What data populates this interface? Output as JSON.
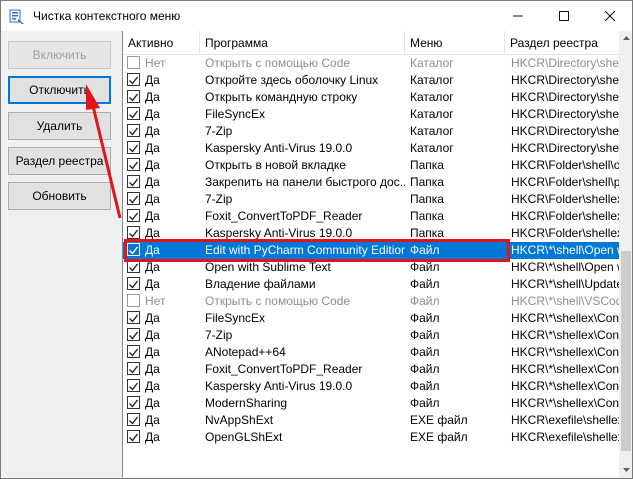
{
  "window": {
    "title": "Чистка контекстного меню",
    "controls": {
      "minimize": "minimize-icon",
      "maximize": "maximize-icon",
      "close": "close-icon"
    }
  },
  "buttons": {
    "enable": "Включить",
    "disable": "Отключить",
    "delete": "Удалить",
    "registry": "Раздел реестра",
    "refresh": "Обновить"
  },
  "columns": {
    "active": "Активно",
    "program": "Программа",
    "menu": "Меню",
    "registry": "Раздел реестра"
  },
  "rows": [
    {
      "checked": false,
      "active": "Нет",
      "program": "Открыть с помощью Code",
      "menu": "Каталог",
      "registry": "HKCR\\Directory\\shell\\VSCode",
      "selected": false
    },
    {
      "checked": true,
      "active": "Да",
      "program": "Откройте здесь оболочку Linux",
      "menu": "Каталог",
      "registry": "HKCR\\Directory\\shell\\WSL",
      "selected": false
    },
    {
      "checked": true,
      "active": "Да",
      "program": "Открыть командную строку",
      "menu": "Каталог",
      "registry": "HKCR\\Directory\\shell\\cmd",
      "selected": false
    },
    {
      "checked": true,
      "active": "Да",
      "program": " FileSyncEx",
      "menu": "Каталог",
      "registry": "HKCR\\Directory\\shellex",
      "selected": false
    },
    {
      "checked": true,
      "active": "Да",
      "program": "7-Zip",
      "menu": "Каталог",
      "registry": "HKCR\\Directory\\shellex",
      "selected": false
    },
    {
      "checked": true,
      "active": "Да",
      "program": "Kaspersky Anti-Virus 19.0.0",
      "menu": "Каталог",
      "registry": "HKCR\\Directory\\shellex",
      "selected": false
    },
    {
      "checked": true,
      "active": "Да",
      "program": "Открыть в новой вкладке",
      "menu": "Папка",
      "registry": "HKCR\\Folder\\shell\\opennewtab",
      "selected": false
    },
    {
      "checked": true,
      "active": "Да",
      "program": "Закрепить на панели быстрого дос...",
      "menu": "Папка",
      "registry": "HKCR\\Folder\\shell\\pintohome",
      "selected": false
    },
    {
      "checked": true,
      "active": "Да",
      "program": "7-Zip",
      "menu": "Папка",
      "registry": "HKCR\\Folder\\shellex\\ContextMenuHandlers",
      "selected": false
    },
    {
      "checked": true,
      "active": "Да",
      "program": "Foxit_ConvertToPDF_Reader",
      "menu": "Папка",
      "registry": "HKCR\\Folder\\shellex\\ContextMenuHandlers",
      "selected": false
    },
    {
      "checked": true,
      "active": "Да",
      "program": "Kaspersky Anti-Virus 19.0.0",
      "menu": "Папка",
      "registry": "HKCR\\Folder\\shellex\\ContextMenuHandlers",
      "selected": false
    },
    {
      "checked": true,
      "active": "Да",
      "program": "Edit with PyCharm Community Edition",
      "menu": "Файл",
      "registry": "HKCR\\*\\shell\\Open with PyCharm",
      "selected": true
    },
    {
      "checked": true,
      "active": "Да",
      "program": "Open with Sublime Text",
      "menu": "Файл",
      "registry": "HKCR\\*\\shell\\Open with Sublime",
      "selected": false
    },
    {
      "checked": true,
      "active": "Да",
      "program": "Владение файлами",
      "menu": "Файл",
      "registry": "HKCR\\*\\shell\\UpdateEncryption",
      "selected": false
    },
    {
      "checked": false,
      "active": "Нет",
      "program": "Открыть с помощью Code",
      "menu": "Файл",
      "registry": "HKCR\\*\\shell\\VSCode",
      "selected": false
    },
    {
      "checked": true,
      "active": "Да",
      "program": " FileSyncEx",
      "menu": "Файл",
      "registry": "HKCR\\*\\shellex\\ContextMenuHandlers",
      "selected": false
    },
    {
      "checked": true,
      "active": "Да",
      "program": "7-Zip",
      "menu": "Файл",
      "registry": "HKCR\\*\\shellex\\ContextMenuHandlers",
      "selected": false
    },
    {
      "checked": true,
      "active": "Да",
      "program": "ANotepad++64",
      "menu": "Файл",
      "registry": "HKCR\\*\\shellex\\ContextMenuHandlers",
      "selected": false
    },
    {
      "checked": true,
      "active": "Да",
      "program": "Foxit_ConvertToPDF_Reader",
      "menu": "Файл",
      "registry": "HKCR\\*\\shellex\\ContextMenuHandlers",
      "selected": false
    },
    {
      "checked": true,
      "active": "Да",
      "program": "Kaspersky Anti-Virus 19.0.0",
      "menu": "Файл",
      "registry": "HKCR\\*\\shellex\\ContextMenuHandlers",
      "selected": false
    },
    {
      "checked": true,
      "active": "Да",
      "program": "ModernSharing",
      "menu": "Файл",
      "registry": "HKCR\\*\\shellex\\ContextMenuHandlers",
      "selected": false
    },
    {
      "checked": true,
      "active": "Да",
      "program": "NvAppShExt",
      "menu": "EXE файл",
      "registry": "HKCR\\exefile\\shellex\\ContextMenuHandlers",
      "selected": false
    },
    {
      "checked": true,
      "active": "Да",
      "program": "OpenGLShExt",
      "menu": "EXE файл",
      "registry": "HKCR\\exefile\\shellex\\ContextMenuHandlers",
      "selected": false
    }
  ],
  "annotation_color": "#e0151b",
  "selection_color": "#0078d7"
}
